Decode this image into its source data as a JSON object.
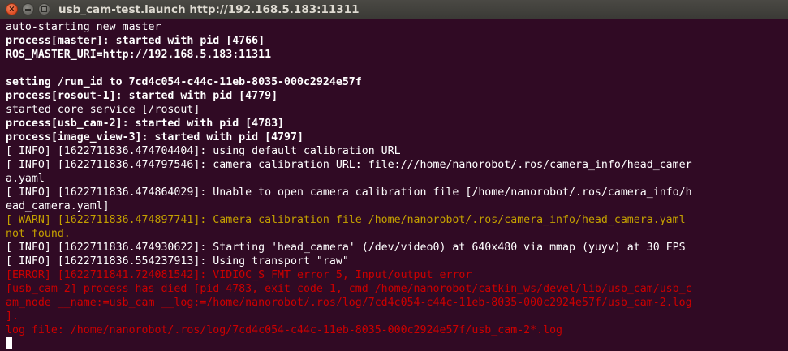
{
  "window": {
    "title": "usb_cam-test.launch http://192.168.5.183:11311",
    "close_glyph": "×",
    "background": "#300a24"
  },
  "colors": {
    "text": "#ffffff",
    "warn": "#c4a000",
    "error": "#cc0000"
  },
  "terminal": {
    "lines": [
      {
        "text": "auto-starting new master",
        "style": "normal"
      },
      {
        "text": "process[master]: started with pid [4766]",
        "style": "bold"
      },
      {
        "text": "ROS_MASTER_URI=http://192.168.5.183:11311",
        "style": "bold"
      },
      {
        "text": "",
        "style": "normal"
      },
      {
        "text": "setting /run_id to 7cd4c054-c44c-11eb-8035-000c2924e57f",
        "style": "bold"
      },
      {
        "text": "process[rosout-1]: started with pid [4779]",
        "style": "bold"
      },
      {
        "text": "started core service [/rosout]",
        "style": "normal"
      },
      {
        "text": "process[usb_cam-2]: started with pid [4783]",
        "style": "bold"
      },
      {
        "text": "process[image_view-3]: started with pid [4797]",
        "style": "bold"
      },
      {
        "text": "[ INFO] [1622711836.474704404]: using default calibration URL",
        "style": "normal"
      },
      {
        "text": "[ INFO] [1622711836.474797546]: camera calibration URL: file:///home/nanorobot/.ros/camera_info/head_camer",
        "style": "normal"
      },
      {
        "text": "a.yaml",
        "style": "normal"
      },
      {
        "text": "[ INFO] [1622711836.474864029]: Unable to open camera calibration file [/home/nanorobot/.ros/camera_info/h",
        "style": "normal"
      },
      {
        "text": "ead_camera.yaml]",
        "style": "normal"
      },
      {
        "text": "[ WARN] [1622711836.474897741]: Camera calibration file /home/nanorobot/.ros/camera_info/head_camera.yaml",
        "style": "warn"
      },
      {
        "text": "not found.",
        "style": "warn"
      },
      {
        "text": "[ INFO] [1622711836.474930622]: Starting 'head_camera' (/dev/video0) at 640x480 via mmap (yuyv) at 30 FPS",
        "style": "normal"
      },
      {
        "text": "[ INFO] [1622711836.554237913]: Using transport \"raw\"",
        "style": "normal"
      },
      {
        "text": "[ERROR] [1622711841.724081542]: VIDIOC_S_FMT error 5, Input/output error",
        "style": "error"
      },
      {
        "text": "[usb_cam-2] process has died [pid 4783, exit code 1, cmd /home/nanorobot/catkin_ws/devel/lib/usb_cam/usb_c",
        "style": "error"
      },
      {
        "text": "am_node __name:=usb_cam __log:=/home/nanorobot/.ros/log/7cd4c054-c44c-11eb-8035-000c2924e57f/usb_cam-2.log",
        "style": "error"
      },
      {
        "text": "].",
        "style": "error"
      },
      {
        "text": "log file: /home/nanorobot/.ros/log/7cd4c054-c44c-11eb-8035-000c2924e57f/usb_cam-2*.log",
        "style": "error"
      }
    ]
  }
}
